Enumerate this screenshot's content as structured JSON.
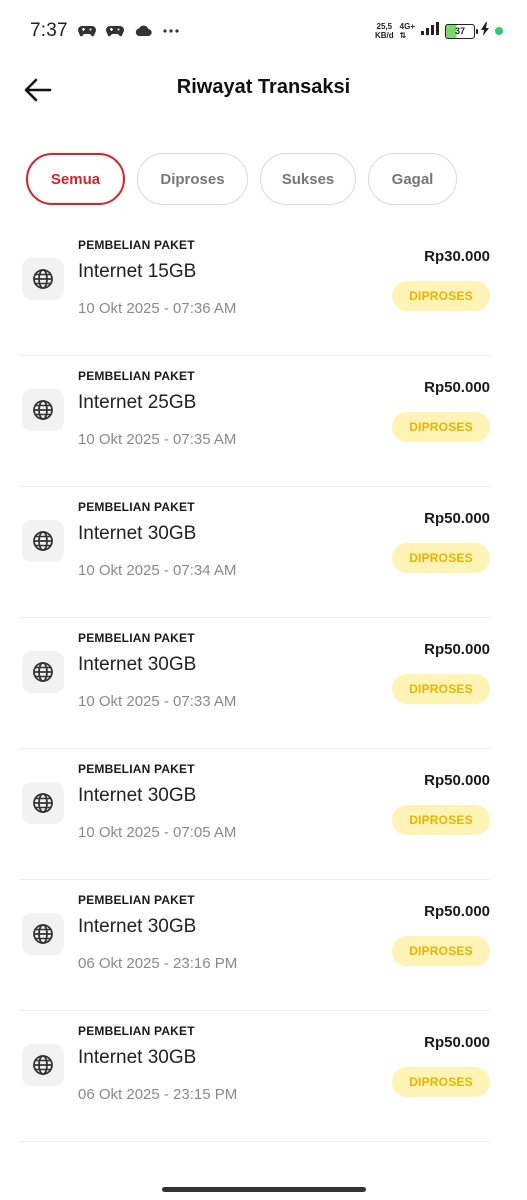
{
  "status_bar": {
    "time": "7:37",
    "net_speed_value": "25,5",
    "net_speed_unit": "KB/d",
    "net_type": "4G+",
    "battery_level": "37",
    "icons": [
      "game-controller-icon",
      "game-controller-icon",
      "cloud-icon",
      "more-dots-icon"
    ]
  },
  "header": {
    "title": "Riwayat Transaksi",
    "back_icon": "arrow-left-icon"
  },
  "tabs": [
    {
      "label": "Semua",
      "active": true
    },
    {
      "label": "Diproses",
      "active": false
    },
    {
      "label": "Sukses",
      "active": false
    },
    {
      "label": "Gagal",
      "active": false
    }
  ],
  "transactions": [
    {
      "category": "PEMBELIAN PAKET",
      "title": "Internet 15GB",
      "date": "10 Okt 2025 - 07:36 AM",
      "amount": "Rp30.000",
      "status": "DIPROSES",
      "icon": "globe-icon"
    },
    {
      "category": "PEMBELIAN PAKET",
      "title": "Internet 25GB",
      "date": "10 Okt 2025 - 07:35 AM",
      "amount": "Rp50.000",
      "status": "DIPROSES",
      "icon": "globe-icon"
    },
    {
      "category": "PEMBELIAN PAKET",
      "title": "Internet 30GB",
      "date": "10 Okt 2025 - 07:34 AM",
      "amount": "Rp50.000",
      "status": "DIPROSES",
      "icon": "globe-icon"
    },
    {
      "category": "PEMBELIAN PAKET",
      "title": "Internet 30GB",
      "date": "10 Okt 2025 - 07:33 AM",
      "amount": "Rp50.000",
      "status": "DIPROSES",
      "icon": "globe-icon"
    },
    {
      "category": "PEMBELIAN PAKET",
      "title": "Internet 30GB",
      "date": "10 Okt 2025 - 07:05 AM",
      "amount": "Rp50.000",
      "status": "DIPROSES",
      "icon": "globe-icon"
    },
    {
      "category": "PEMBELIAN PAKET",
      "title": "Internet 30GB",
      "date": "06 Okt 2025 - 23:16 PM",
      "amount": "Rp50.000",
      "status": "DIPROSES",
      "icon": "globe-icon"
    },
    {
      "category": "PEMBELIAN PAKET",
      "title": "Internet 30GB",
      "date": "06 Okt 2025 - 23:15 PM",
      "amount": "Rp50.000",
      "status": "DIPROSES",
      "icon": "globe-icon"
    }
  ],
  "colors": {
    "accent": "#d8232a",
    "badge_bg": "#fff3b5",
    "badge_text": "#e8b400"
  }
}
